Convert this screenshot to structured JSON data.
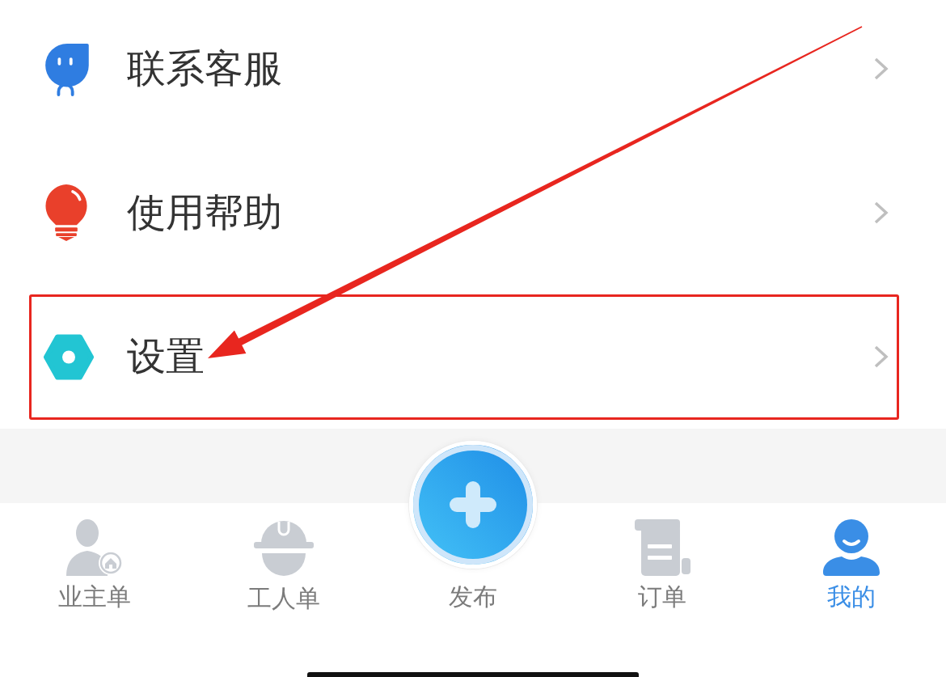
{
  "menu": {
    "items": [
      {
        "label": "联系客服",
        "highlighted": false
      },
      {
        "label": "使用帮助",
        "highlighted": false
      },
      {
        "label": "设置",
        "highlighted": true
      }
    ]
  },
  "tab_bar": {
    "tabs": [
      {
        "kind": "tab",
        "label": "业主单",
        "selected": false
      },
      {
        "kind": "tab",
        "label": "工人单",
        "selected": false
      },
      {
        "kind": "action",
        "label": "发布",
        "selected": false
      },
      {
        "kind": "tab",
        "label": "订单",
        "selected": false
      },
      {
        "kind": "tab",
        "label": "我的",
        "selected": true
      }
    ]
  }
}
